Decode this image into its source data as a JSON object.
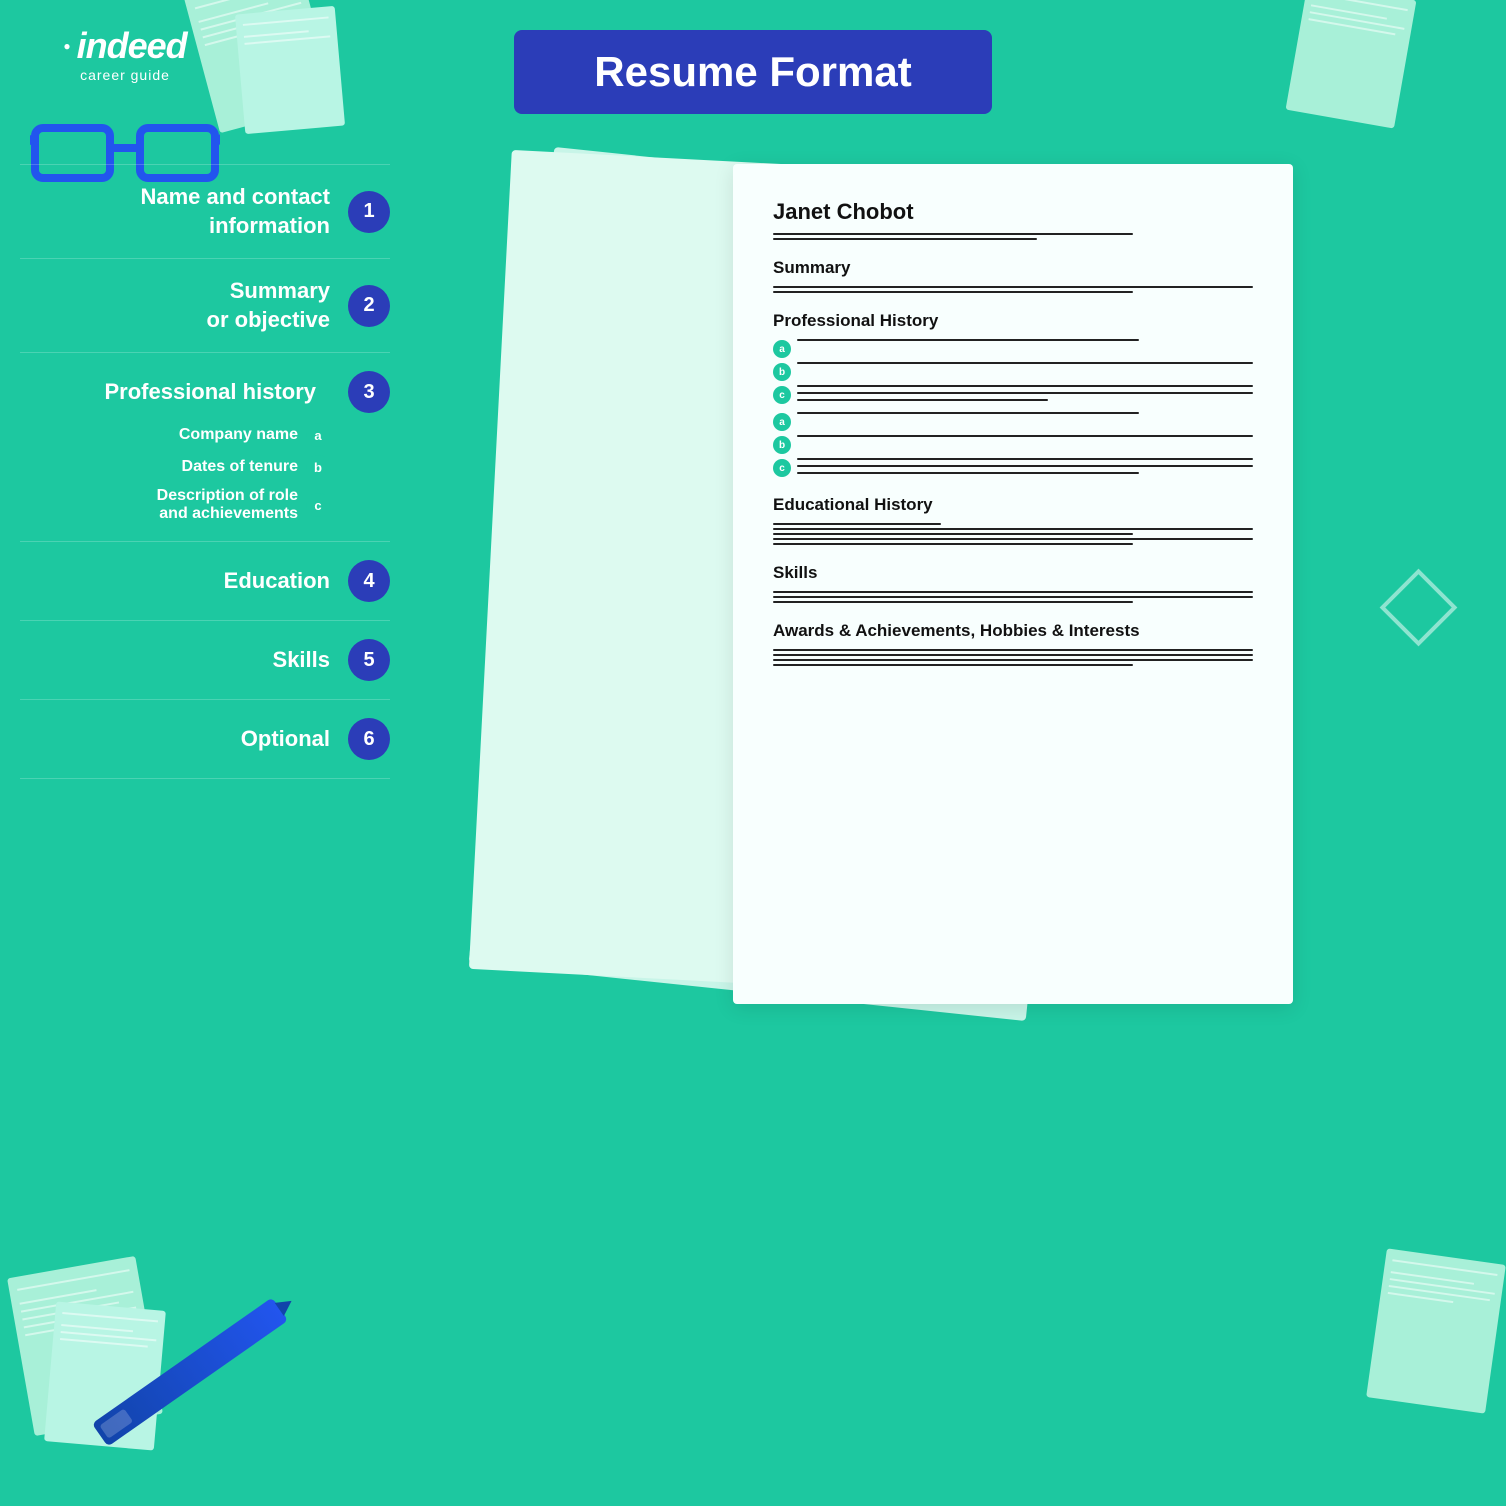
{
  "header": {
    "logo": {
      "brand": "indeed",
      "tagline": "career guide"
    },
    "title": "Resume Format"
  },
  "menu": {
    "items": [
      {
        "id": 1,
        "label": "Name and contact\ninformation",
        "badge": "1",
        "subItems": []
      },
      {
        "id": 2,
        "label": "Summary\nor objective",
        "badge": "2",
        "subItems": []
      },
      {
        "id": 3,
        "label": "Professional history",
        "badge": "3",
        "subItems": [
          {
            "label": "Company name",
            "badge": "a"
          },
          {
            "label": "Dates of tenure",
            "badge": "b"
          },
          {
            "label": "Description of role\nand achievements",
            "badge": "c"
          }
        ]
      },
      {
        "id": 4,
        "label": "Education",
        "badge": "4",
        "subItems": []
      },
      {
        "id": 5,
        "label": "Skills",
        "badge": "5",
        "subItems": []
      },
      {
        "id": 6,
        "label": "Optional",
        "badge": "6",
        "subItems": []
      }
    ]
  },
  "resume": {
    "name": "Janet Chobot",
    "sections": [
      {
        "title": "Summary"
      },
      {
        "title": "Professional History"
      },
      {
        "title": "Educational History"
      },
      {
        "title": "Skills"
      },
      {
        "title": "Awards & Achievements, Hobbies & Interests"
      }
    ]
  },
  "colors": {
    "bg": "#1dc8a0",
    "accent_blue": "#2b3db8",
    "paper": "#f8fffe",
    "text": "#111111"
  }
}
